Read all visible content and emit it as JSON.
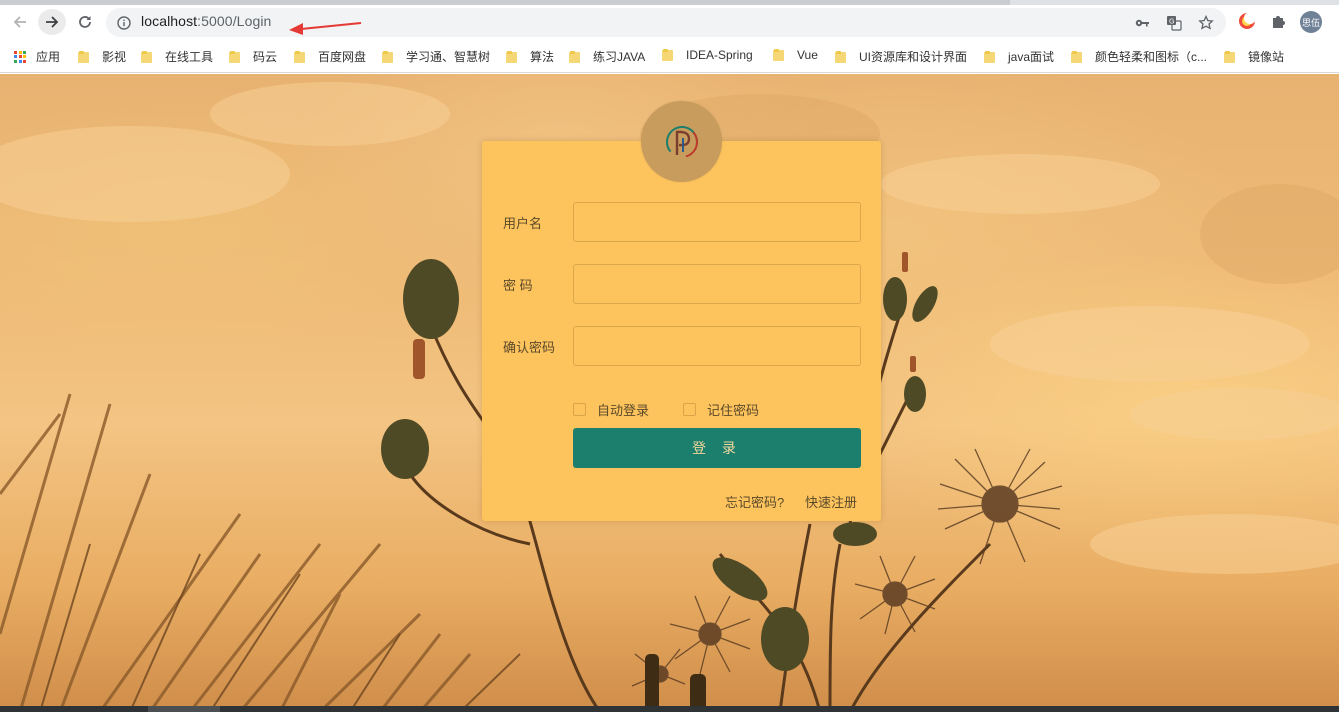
{
  "browser": {
    "url_host": "localhost",
    "url_rest": ":5000/Login",
    "profile_label": "思伍"
  },
  "bookmarks": {
    "apps_label": "应用",
    "items": [
      {
        "label": "影视"
      },
      {
        "label": "在线工具"
      },
      {
        "label": "码云"
      },
      {
        "label": "百度网盘"
      },
      {
        "label": "学习通、智慧树"
      },
      {
        "label": "算法"
      },
      {
        "label": "练习JAVA"
      },
      {
        "label": "IDEA-Spring"
      },
      {
        "label": "Vue"
      },
      {
        "label": "UI资源库和设计界面"
      },
      {
        "label": "java面试"
      },
      {
        "label": "颜色轻柔和图标（c..."
      },
      {
        "label": "镜像站"
      }
    ]
  },
  "login": {
    "username_label": "用户名",
    "password_label": "密 码",
    "confirm_label": "确认密码",
    "username_value": "",
    "password_value": "",
    "confirm_value": "",
    "auto_login_label": "自动登录",
    "remember_label": "记住密码",
    "submit_label": "登 录",
    "forgot_label": "忘记密码?",
    "register_label": "快速注册"
  },
  "colors": {
    "card": "#fdc35d",
    "button": "#1c7e6d",
    "logo_bg": "#c89c5c",
    "annotation_arrow": "#e53935"
  },
  "icons": {
    "back": "arrow-left-icon",
    "forward": "arrow-right-icon",
    "reload": "reload-icon",
    "info": "info-icon",
    "key": "key-icon",
    "translate": "translate-icon",
    "star": "star-icon",
    "extensions": "puzzle-icon",
    "logo": "p-logo-icon"
  }
}
